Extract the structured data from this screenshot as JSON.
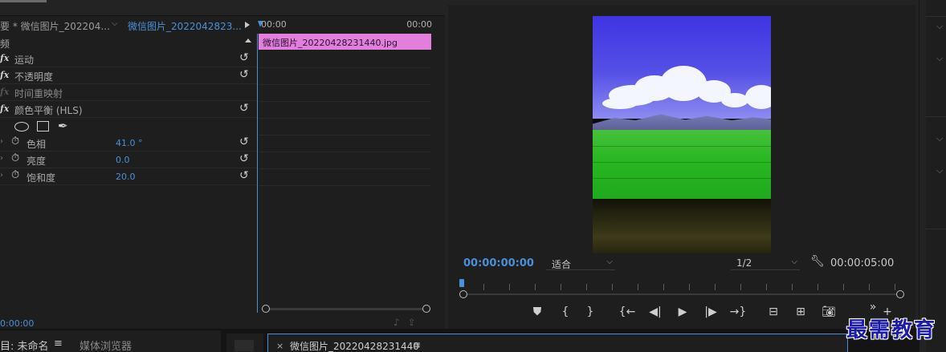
{
  "effect_controls": {
    "master_clip": "要 * 微信图片_202204...",
    "dropdown": "⌵",
    "active_clip": "微信图片_2022042823...",
    "section": "频",
    "effects": [
      {
        "fx": "fx",
        "label": "运动",
        "reset": "↺"
      },
      {
        "fx": "fx",
        "label": "不透明度",
        "reset": "↺"
      },
      {
        "fx": "fx",
        "label": "时间重映射",
        "reset": ""
      },
      {
        "fx": "fx",
        "label": "颜色平衡 (HLS)",
        "reset": "↺"
      }
    ],
    "properties": [
      {
        "name": "色相",
        "value": "41.0 °"
      },
      {
        "name": "亮度",
        "value": "0.0"
      },
      {
        "name": "饱和度",
        "value": "20.0"
      }
    ],
    "timecode": "0:00:00"
  },
  "mini_timeline": {
    "start": "00:00",
    "end": "00:00",
    "clip_name": "微信图片_20220428231440.jpg",
    "clip_color": "#e27fdc"
  },
  "program_monitor": {
    "timecode": "00:00:00:00",
    "fit": "适合",
    "resolution": "1/2",
    "duration": "00:00:05:00",
    "more": "»",
    "add": "+"
  },
  "bottom": {
    "project_tab": "目: 未命名",
    "project_menu": "≡",
    "media_browser": "媒体浏览器",
    "sequence_close": "×",
    "sequence_name": "微信图片_20220428231440",
    "sequence_menu": "≡"
  },
  "watermark": "最需教育",
  "colors": {
    "accent": "#4a90d9",
    "panel": "#1e1e1e"
  }
}
